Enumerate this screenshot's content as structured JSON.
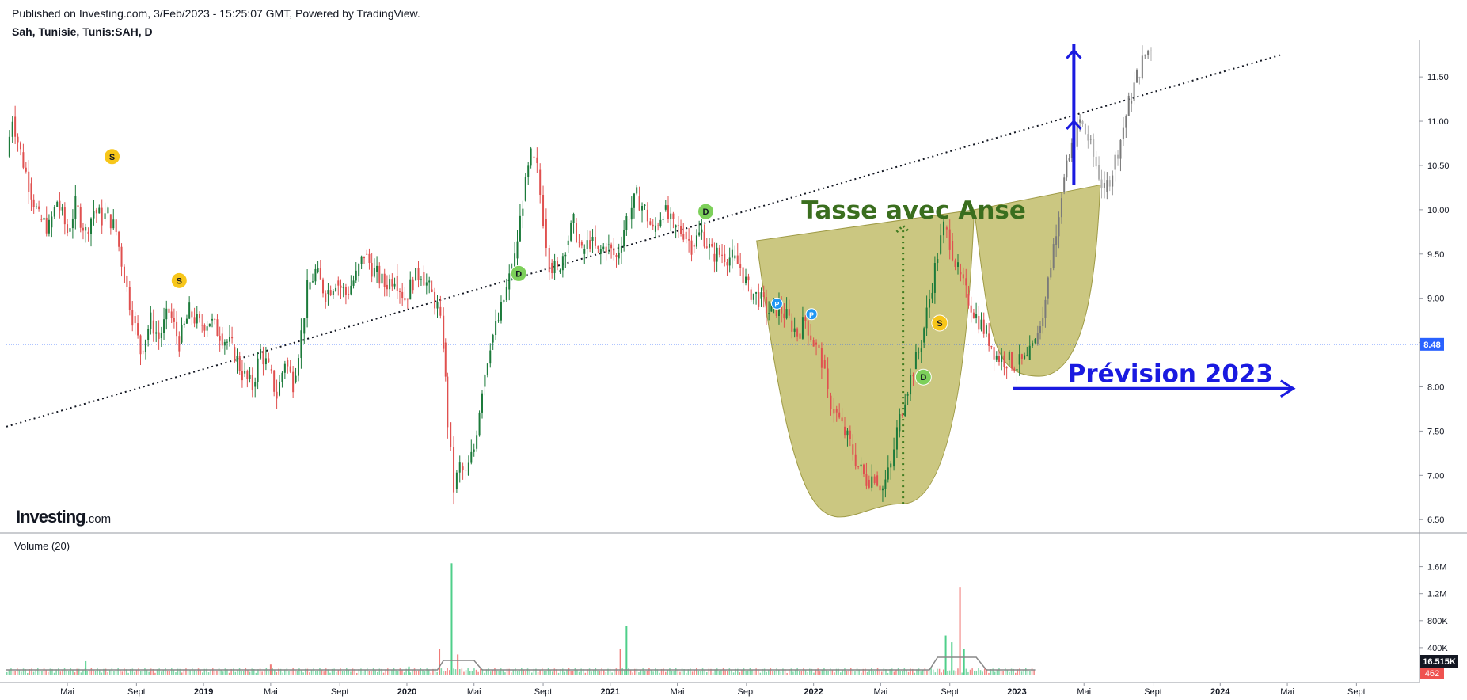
{
  "header": {
    "published": "Published on Investing.com, 3/Feb/2023 - 15:25:07 GMT, Powered by TradingView.",
    "symbol": "Sah, Tunisie, Tunis:SAH, D"
  },
  "logo": {
    "main": "Investing",
    "suffix": ".com"
  },
  "volume_label": "Volume (20)",
  "colors": {
    "up": "#26a69a",
    "down": "#ef5350",
    "cup_fill": "#c2bd6b",
    "pattern_text": "#3a6e1e",
    "forecast": "#1a1ae0",
    "price_line": "#2962ff",
    "price_tag": "#2962ff",
    "volume_tag": "#131722",
    "volume_down_tag": "#ef5350"
  },
  "chart_data": {
    "type": "line",
    "price_axis": {
      "ticks": [
        "11.50",
        "11.00",
        "10.50",
        "10.00",
        "9.50",
        "9.00",
        "8.50",
        "8.00",
        "7.50",
        "7.00",
        "6.50"
      ],
      "range": [
        6.35,
        11.85
      ],
      "current": "8.48"
    },
    "volume_axis": {
      "ticks": [
        "1.6M",
        "1.2M",
        "800K",
        "400K"
      ],
      "range": [
        0,
        1900000
      ],
      "current": "16.515K",
      "down": "462"
    },
    "time_axis": {
      "ticks": [
        {
          "label": "Mai",
          "t": 2018.33,
          "bold": false
        },
        {
          "label": "Sept",
          "t": 2018.67,
          "bold": false
        },
        {
          "label": "2019",
          "t": 2019.0,
          "bold": true
        },
        {
          "label": "Mai",
          "t": 2019.33,
          "bold": false
        },
        {
          "label": "Sept",
          "t": 2019.67,
          "bold": false
        },
        {
          "label": "2020",
          "t": 2020.0,
          "bold": true
        },
        {
          "label": "Mai",
          "t": 2020.33,
          "bold": false
        },
        {
          "label": "Sept",
          "t": 2020.67,
          "bold": false
        },
        {
          "label": "2021",
          "t": 2021.0,
          "bold": true
        },
        {
          "label": "Mai",
          "t": 2021.33,
          "bold": false
        },
        {
          "label": "Sept",
          "t": 2021.67,
          "bold": false
        },
        {
          "label": "2022",
          "t": 2022.0,
          "bold": true
        },
        {
          "label": "Mai",
          "t": 2022.33,
          "bold": false
        },
        {
          "label": "Sept",
          "t": 2022.67,
          "bold": false
        },
        {
          "label": "2023",
          "t": 2023.0,
          "bold": true
        },
        {
          "label": "Mai",
          "t": 2023.33,
          "bold": false
        },
        {
          "label": "Sept",
          "t": 2023.67,
          "bold": false
        },
        {
          "label": "2024",
          "t": 2024.0,
          "bold": true
        },
        {
          "label": "Mai",
          "t": 2024.33,
          "bold": false
        },
        {
          "label": "Sept",
          "t": 2024.67,
          "bold": false
        }
      ],
      "range": [
        2018.03,
        2024.98
      ]
    },
    "price_series": [
      {
        "t": 2018.03,
        "v": 10.6
      },
      {
        "t": 2018.06,
        "v": 11.05
      },
      {
        "t": 2018.1,
        "v": 10.65
      },
      {
        "t": 2018.14,
        "v": 10.3
      },
      {
        "t": 2018.19,
        "v": 9.9
      },
      {
        "t": 2018.24,
        "v": 9.8
      },
      {
        "t": 2018.28,
        "v": 10.1
      },
      {
        "t": 2018.33,
        "v": 9.75
      },
      {
        "t": 2018.37,
        "v": 10.05
      },
      {
        "t": 2018.42,
        "v": 9.75
      },
      {
        "t": 2018.46,
        "v": 10.0
      },
      {
        "t": 2018.5,
        "v": 9.9
      },
      {
        "t": 2018.53,
        "v": 9.95
      },
      {
        "t": 2018.57,
        "v": 9.75
      },
      {
        "t": 2018.61,
        "v": 9.25
      },
      {
        "t": 2018.65,
        "v": 8.8
      },
      {
        "t": 2018.69,
        "v": 8.4
      },
      {
        "t": 2018.74,
        "v": 8.75
      },
      {
        "t": 2018.78,
        "v": 8.55
      },
      {
        "t": 2018.83,
        "v": 8.85
      },
      {
        "t": 2018.88,
        "v": 8.5
      },
      {
        "t": 2018.93,
        "v": 8.85
      },
      {
        "t": 2018.98,
        "v": 8.7
      },
      {
        "t": 2019.03,
        "v": 8.75
      },
      {
        "t": 2019.08,
        "v": 8.6
      },
      {
        "t": 2019.14,
        "v": 8.45
      },
      {
        "t": 2019.19,
        "v": 8.15
      },
      {
        "t": 2019.24,
        "v": 8.0
      },
      {
        "t": 2019.28,
        "v": 8.4
      },
      {
        "t": 2019.32,
        "v": 8.2
      },
      {
        "t": 2019.36,
        "v": 7.9
      },
      {
        "t": 2019.4,
        "v": 8.3
      },
      {
        "t": 2019.44,
        "v": 8.05
      },
      {
        "t": 2019.48,
        "v": 8.6
      },
      {
        "t": 2019.51,
        "v": 9.1
      },
      {
        "t": 2019.55,
        "v": 9.3
      },
      {
        "t": 2019.6,
        "v": 9.05
      },
      {
        "t": 2019.65,
        "v": 9.2
      },
      {
        "t": 2019.7,
        "v": 9.05
      },
      {
        "t": 2019.75,
        "v": 9.25
      },
      {
        "t": 2019.79,
        "v": 9.5
      },
      {
        "t": 2019.84,
        "v": 9.3
      },
      {
        "t": 2019.89,
        "v": 9.15
      },
      {
        "t": 2019.94,
        "v": 9.25
      },
      {
        "t": 2019.99,
        "v": 9.0
      },
      {
        "t": 2020.03,
        "v": 9.2
      },
      {
        "t": 2020.07,
        "v": 9.3
      },
      {
        "t": 2020.11,
        "v": 9.1
      },
      {
        "t": 2020.15,
        "v": 8.9
      },
      {
        "t": 2020.18,
        "v": 8.5
      },
      {
        "t": 2020.2,
        "v": 7.6
      },
      {
        "t": 2020.23,
        "v": 6.85
      },
      {
        "t": 2020.26,
        "v": 7.1
      },
      {
        "t": 2020.29,
        "v": 7.0
      },
      {
        "t": 2020.33,
        "v": 7.3
      },
      {
        "t": 2020.37,
        "v": 8.0
      },
      {
        "t": 2020.41,
        "v": 8.5
      },
      {
        "t": 2020.45,
        "v": 8.75
      },
      {
        "t": 2020.49,
        "v": 9.1
      },
      {
        "t": 2020.53,
        "v": 9.45
      },
      {
        "t": 2020.57,
        "v": 10.1
      },
      {
        "t": 2020.61,
        "v": 10.6
      },
      {
        "t": 2020.64,
        "v": 10.45
      },
      {
        "t": 2020.67,
        "v": 9.9
      },
      {
        "t": 2020.7,
        "v": 9.4
      },
      {
        "t": 2020.74,
        "v": 9.3
      },
      {
        "t": 2020.78,
        "v": 9.6
      },
      {
        "t": 2020.82,
        "v": 9.85
      },
      {
        "t": 2020.86,
        "v": 9.5
      },
      {
        "t": 2020.9,
        "v": 9.65
      },
      {
        "t": 2020.94,
        "v": 9.5
      },
      {
        "t": 2020.98,
        "v": 9.6
      },
      {
        "t": 2021.03,
        "v": 9.45
      },
      {
        "t": 2021.08,
        "v": 9.9
      },
      {
        "t": 2021.13,
        "v": 10.15
      },
      {
        "t": 2021.17,
        "v": 10.0
      },
      {
        "t": 2021.21,
        "v": 9.75
      },
      {
        "t": 2021.26,
        "v": 10.0
      },
      {
        "t": 2021.31,
        "v": 9.8
      },
      {
        "t": 2021.36,
        "v": 9.75
      },
      {
        "t": 2021.4,
        "v": 9.6
      },
      {
        "t": 2021.45,
        "v": 9.75
      },
      {
        "t": 2021.5,
        "v": 9.5
      },
      {
        "t": 2021.55,
        "v": 9.5
      },
      {
        "t": 2021.6,
        "v": 9.45
      },
      {
        "t": 2021.64,
        "v": 9.35
      },
      {
        "t": 2021.68,
        "v": 9.1
      },
      {
        "t": 2021.73,
        "v": 9.0
      },
      {
        "t": 2021.78,
        "v": 8.85
      },
      {
        "t": 2021.83,
        "v": 8.9
      },
      {
        "t": 2021.88,
        "v": 8.75
      },
      {
        "t": 2021.92,
        "v": 8.6
      },
      {
        "t": 2021.96,
        "v": 8.75
      },
      {
        "t": 2022.0,
        "v": 8.5
      },
      {
        "t": 2022.04,
        "v": 8.3
      },
      {
        "t": 2022.07,
        "v": 7.9
      },
      {
        "t": 2022.1,
        "v": 7.75
      },
      {
        "t": 2022.14,
        "v": 7.55
      },
      {
        "t": 2022.18,
        "v": 7.35
      },
      {
        "t": 2022.22,
        "v": 7.1
      },
      {
        "t": 2022.26,
        "v": 6.95
      },
      {
        "t": 2022.3,
        "v": 7.0
      },
      {
        "t": 2022.34,
        "v": 6.85
      },
      {
        "t": 2022.38,
        "v": 7.1
      },
      {
        "t": 2022.41,
        "v": 7.5
      },
      {
        "t": 2022.45,
        "v": 7.9
      },
      {
        "t": 2022.49,
        "v": 8.2
      },
      {
        "t": 2022.53,
        "v": 8.5
      },
      {
        "t": 2022.57,
        "v": 9.0
      },
      {
        "t": 2022.61,
        "v": 9.5
      },
      {
        "t": 2022.64,
        "v": 9.8
      },
      {
        "t": 2022.67,
        "v": 9.65
      },
      {
        "t": 2022.71,
        "v": 9.3
      },
      {
        "t": 2022.75,
        "v": 9.05
      },
      {
        "t": 2022.8,
        "v": 8.8
      },
      {
        "t": 2022.85,
        "v": 8.6
      },
      {
        "t": 2022.9,
        "v": 8.35
      },
      {
        "t": 2022.95,
        "v": 8.3
      },
      {
        "t": 2023.0,
        "v": 8.25
      },
      {
        "t": 2023.05,
        "v": 8.3
      },
      {
        "t": 2023.09,
        "v": 8.48
      }
    ],
    "forecast_series": [
      {
        "t": 2023.09,
        "v": 8.48
      },
      {
        "t": 2023.14,
        "v": 9.0
      },
      {
        "t": 2023.18,
        "v": 9.6
      },
      {
        "t": 2023.22,
        "v": 10.2
      },
      {
        "t": 2023.27,
        "v": 10.7
      },
      {
        "t": 2023.31,
        "v": 11.0
      },
      {
        "t": 2023.35,
        "v": 10.8
      },
      {
        "t": 2023.39,
        "v": 10.5
      },
      {
        "t": 2023.43,
        "v": 10.2
      },
      {
        "t": 2023.47,
        "v": 10.45
      },
      {
        "t": 2023.51,
        "v": 10.8
      },
      {
        "t": 2023.55,
        "v": 11.2
      },
      {
        "t": 2023.59,
        "v": 11.5
      },
      {
        "t": 2023.63,
        "v": 11.75
      },
      {
        "t": 2023.66,
        "v": 11.85
      }
    ],
    "volume_spikes": [
      {
        "t": 2020.22,
        "v": 1650000,
        "dir": "up"
      },
      {
        "t": 2020.16,
        "v": 380000,
        "dir": "down"
      },
      {
        "t": 2020.25,
        "v": 300000,
        "dir": "down"
      },
      {
        "t": 2021.05,
        "v": 380000,
        "dir": "down"
      },
      {
        "t": 2021.08,
        "v": 720000,
        "dir": "up"
      },
      {
        "t": 2022.65,
        "v": 580000,
        "dir": "up"
      },
      {
        "t": 2022.68,
        "v": 480000,
        "dir": "up"
      },
      {
        "t": 2022.72,
        "v": 1300000,
        "dir": "down"
      },
      {
        "t": 2022.74,
        "v": 380000,
        "dir": "up"
      },
      {
        "t": 2018.42,
        "v": 200000,
        "dir": "up"
      },
      {
        "t": 2019.33,
        "v": 150000,
        "dir": "down"
      },
      {
        "t": 2020.01,
        "v": 120000,
        "dir": "up"
      }
    ],
    "trendline": {
      "from": {
        "t": 2018.03,
        "v": 7.55
      },
      "to": {
        "t": 2024.3,
        "v": 11.75
      }
    },
    "price_line": 8.48,
    "pattern": {
      "cup": {
        "left": {
          "t": 2021.72,
          "v": 9.65
        },
        "bottom": {
          "t": 2022.44,
          "v": 6.68
        },
        "right": {
          "t": 2022.79,
          "v": 10.0
        }
      },
      "handle": {
        "left": {
          "t": 2022.79,
          "v": 10.0
        },
        "bottom": {
          "t": 2023.11,
          "v": 8.12
        },
        "right": {
          "t": 2023.41,
          "v": 10.28
        }
      },
      "depth_marker": {
        "t": 2022.44,
        "from": 6.68,
        "to": 9.82
      }
    },
    "dividend_markers": [
      {
        "label": "S",
        "t": 2018.55,
        "v": 10.6,
        "color": "#f7c61a"
      },
      {
        "label": "S",
        "t": 2018.88,
        "v": 9.2,
        "color": "#f7c61a"
      },
      {
        "label": "D",
        "t": 2020.55,
        "v": 9.28,
        "color": "#7dd05a"
      },
      {
        "label": "D",
        "t": 2021.47,
        "v": 9.98,
        "color": "#7dd05a"
      },
      {
        "label": "P",
        "t": 2021.82,
        "v": 8.94,
        "color": "#2196f3"
      },
      {
        "label": "P",
        "t": 2021.99,
        "v": 8.82,
        "color": "#2196f3"
      },
      {
        "label": "S",
        "t": 2022.62,
        "v": 8.72,
        "color": "#f7c61a"
      },
      {
        "label": "D",
        "t": 2022.54,
        "v": 8.11,
        "color": "#7dd05a"
      }
    ],
    "annotations": {
      "pattern_title": "Tasse avec Anse",
      "forecast_title": "Prévision 2023"
    }
  }
}
